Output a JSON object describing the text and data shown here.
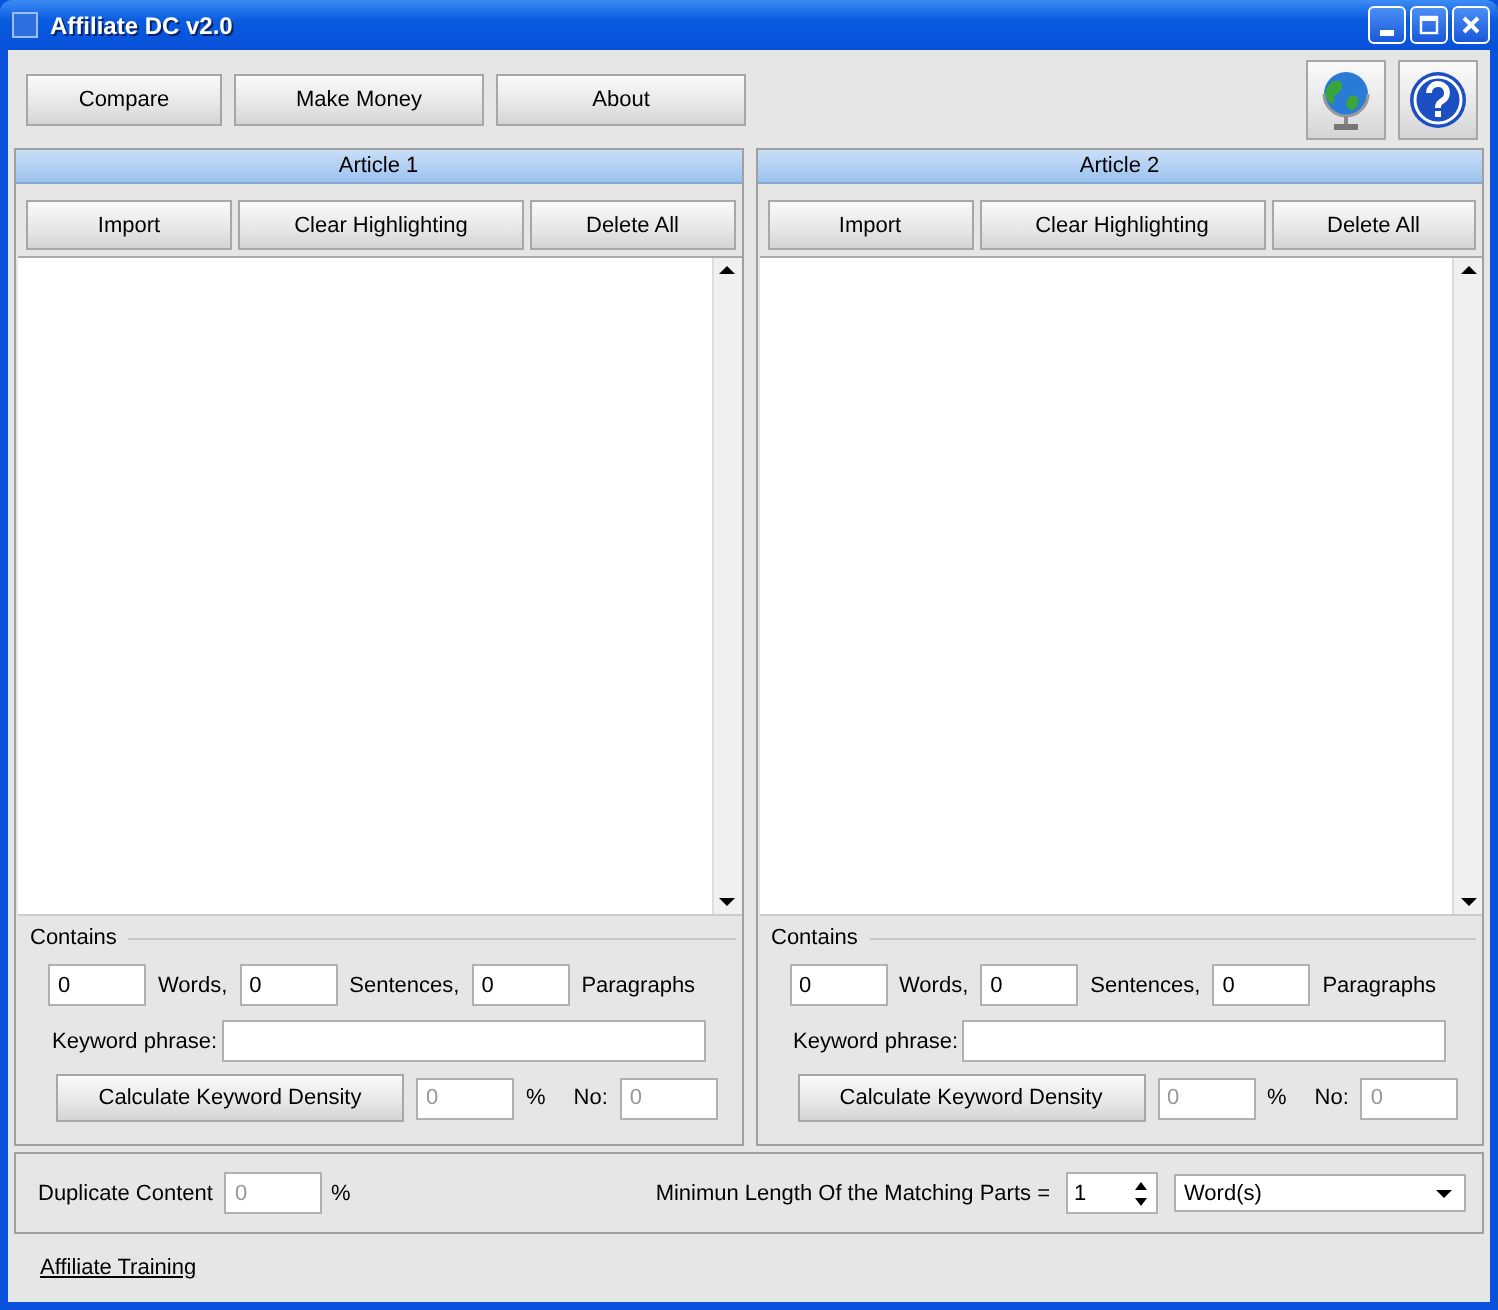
{
  "window": {
    "title": "Affiliate DC v2.0"
  },
  "toolbar": {
    "buttons": [
      "Compare",
      "Make Money",
      "About"
    ]
  },
  "articles": [
    {
      "title": "Article 1",
      "buttons": [
        "Import",
        "Clear Highlighting",
        "Delete All"
      ],
      "contains_label": "Contains",
      "count_row": [
        {
          "kind": "field",
          "value": "0",
          "disabled": false
        },
        {
          "kind": "text",
          "text": "Words,"
        },
        {
          "kind": "field",
          "value": "0",
          "disabled": false
        },
        {
          "kind": "text",
          "text": "Sentences,"
        },
        {
          "kind": "field",
          "value": "0",
          "disabled": false
        },
        {
          "kind": "text",
          "text": "Paragraphs"
        }
      ],
      "keyword_label": "Keyword phrase:",
      "calculate_button": "Calculate Keyword Density",
      "density": {
        "value": "0",
        "disabled": true
      },
      "percent": "%",
      "no_label": "No:",
      "no_field": {
        "value": "0",
        "disabled": true
      }
    },
    {
      "title": "Article 2",
      "buttons": [
        "Import",
        "Clear Highlighting",
        "Delete All"
      ],
      "contains_label": "Contains",
      "count_row": [
        {
          "kind": "field",
          "value": "0",
          "disabled": false
        },
        {
          "kind": "text",
          "text": "Words,"
        },
        {
          "kind": "field",
          "value": "0",
          "disabled": false
        },
        {
          "kind": "text",
          "text": "Sentences,"
        },
        {
          "kind": "field",
          "value": "0",
          "disabled": false
        },
        {
          "kind": "text",
          "text": "Paragraphs"
        }
      ],
      "keyword_label": "Keyword phrase:",
      "calculate_button": "Calculate Keyword Density",
      "density": {
        "value": "0",
        "disabled": true
      },
      "percent": "%",
      "no_label": "No:",
      "no_field": {
        "value": "0",
        "disabled": true
      }
    }
  ],
  "duplicate": {
    "label": "Duplicate Content",
    "value": "0",
    "disabled": true,
    "unit": "%"
  },
  "min_length": {
    "label": "Minimun Length Of the Matching Parts =",
    "value": "1",
    "unit": "Word(s)"
  },
  "link": "Affiliate Training"
}
